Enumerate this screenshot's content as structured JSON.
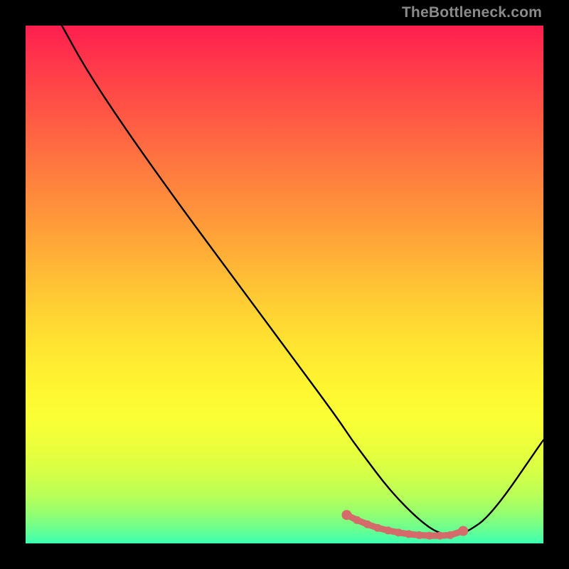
{
  "watermark": "TheBottleneck.com",
  "chart_data": {
    "type": "line",
    "title": "",
    "xlabel": "",
    "ylabel": "",
    "xlim": [
      0,
      100
    ],
    "ylim": [
      0,
      100
    ],
    "grid": false,
    "series": [
      {
        "name": "bottleneck-curve",
        "x": [
          7,
          12,
          20,
          30,
          40,
          50,
          60,
          63,
          66,
          69,
          72,
          75,
          78,
          80,
          82.5,
          85,
          90,
          100
        ],
        "values": [
          100,
          91,
          79,
          65,
          51.5,
          38,
          24.5,
          20,
          16,
          12,
          8.5,
          5.5,
          3,
          2,
          1.5,
          2,
          5.5,
          20
        ]
      }
    ],
    "markers": {
      "name": "highlight-points",
      "color": "#d46a6a",
      "x": [
        62,
        64,
        66,
        68,
        70,
        72,
        74,
        76,
        78,
        80,
        82,
        84.5
      ],
      "values": [
        5.5,
        4.5,
        3.7,
        3.0,
        2.5,
        2.1,
        1.8,
        1.6,
        1.5,
        1.5,
        1.6,
        2.4
      ]
    }
  }
}
